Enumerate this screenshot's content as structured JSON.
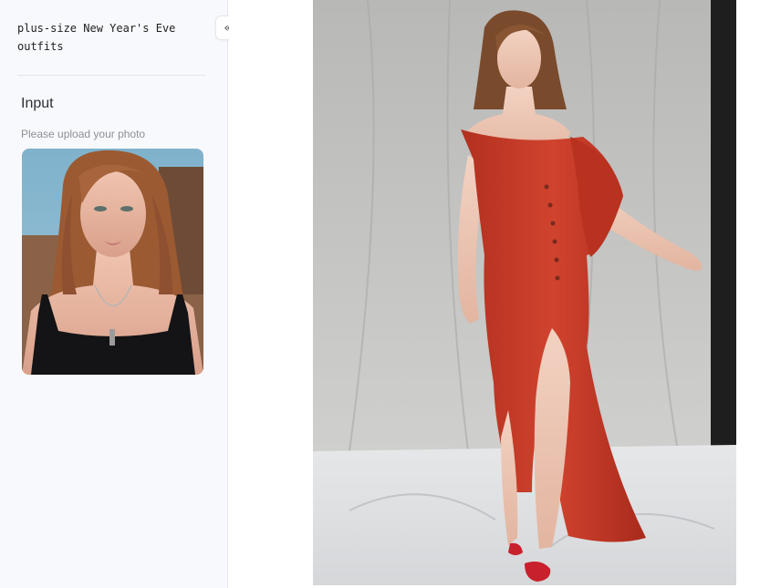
{
  "sidebar": {
    "prompt_text": "plus-size New Year's Eve\noutfits",
    "collapse_icon": "double-chevron-left-icon",
    "collapse_glyph": "«",
    "input": {
      "title": "Input",
      "hint": "Please upload your photo"
    }
  },
  "colors": {
    "sidebar_bg": "#f8f9fc",
    "dress_red": "#c8372b",
    "backdrop_gray": "#c9c9c7"
  }
}
